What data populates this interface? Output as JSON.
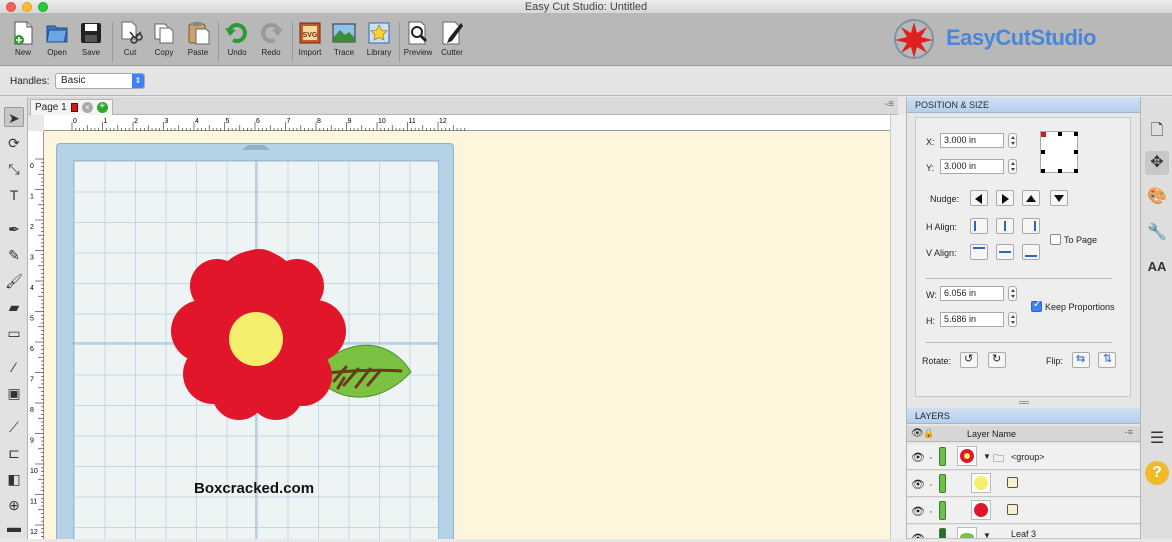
{
  "window": {
    "title": "Easy Cut Studio: Untitled"
  },
  "toolbar": {
    "buttons": [
      {
        "label": "New",
        "icon": "new-document-icon"
      },
      {
        "label": "Open",
        "icon": "open-icon"
      },
      {
        "label": "Save",
        "icon": "save-icon"
      },
      {
        "label": "Cut",
        "icon": "cut-icon"
      },
      {
        "label": "Copy",
        "icon": "copy-icon"
      },
      {
        "label": "Paste",
        "icon": "paste-icon"
      },
      {
        "label": "Undo",
        "icon": "undo-icon"
      },
      {
        "label": "Redo",
        "icon": "redo-icon"
      },
      {
        "label": "Import",
        "icon": "import-svg-icon"
      },
      {
        "label": "Trace",
        "icon": "trace-icon"
      },
      {
        "label": "Library",
        "icon": "library-icon"
      },
      {
        "label": "Preview",
        "icon": "preview-icon"
      },
      {
        "label": "Cutter",
        "icon": "cutter-icon"
      }
    ],
    "logo_text": "EasyCutStudio"
  },
  "options": {
    "handles_label": "Handles:",
    "handles_value": "Basic"
  },
  "tabs": {
    "page_label": "Page 1"
  },
  "ruler": {
    "h_ticks": [
      "0",
      "1",
      "2",
      "3",
      "4",
      "5",
      "6",
      "7",
      "8",
      "9",
      "10",
      "11",
      "12"
    ],
    "v_ticks": [
      "0",
      "1",
      "2",
      "3",
      "4",
      "5",
      "6",
      "7",
      "8",
      "9",
      "10",
      "11",
      "12"
    ]
  },
  "canvas": {
    "watermark": "Boxcracked.com"
  },
  "position_size": {
    "header": "POSITION & SIZE",
    "x_label": "X:",
    "x_value": "3.000 in",
    "y_label": "Y:",
    "y_value": "3.000 in",
    "nudge_label": "Nudge:",
    "h_align_label": "H Align:",
    "v_align_label": "V Align:",
    "to_page_label": "To Page",
    "w_label": "W:",
    "w_value": "6.056 in",
    "h_label": "H:",
    "h_value": "5.686 in",
    "keep_proportions_label": "Keep Proportions",
    "rotate_label": "Rotate:",
    "flip_label": "Flip:"
  },
  "layers": {
    "header": "LAYERS",
    "column_name": "Layer Name",
    "rows": [
      {
        "name": "<group>",
        "thumb": "flower"
      },
      {
        "name": "",
        "thumb": "yellow-circle"
      },
      {
        "name": "",
        "thumb": "red-flower"
      },
      {
        "name": "Leaf 3",
        "thumb": "leaf"
      }
    ]
  },
  "colors": {
    "petal": "#e2162b",
    "center": "#f4ef6c",
    "leaf": "#7bc242",
    "vein": "#6b3a1a",
    "accent": "#3b82f6"
  }
}
